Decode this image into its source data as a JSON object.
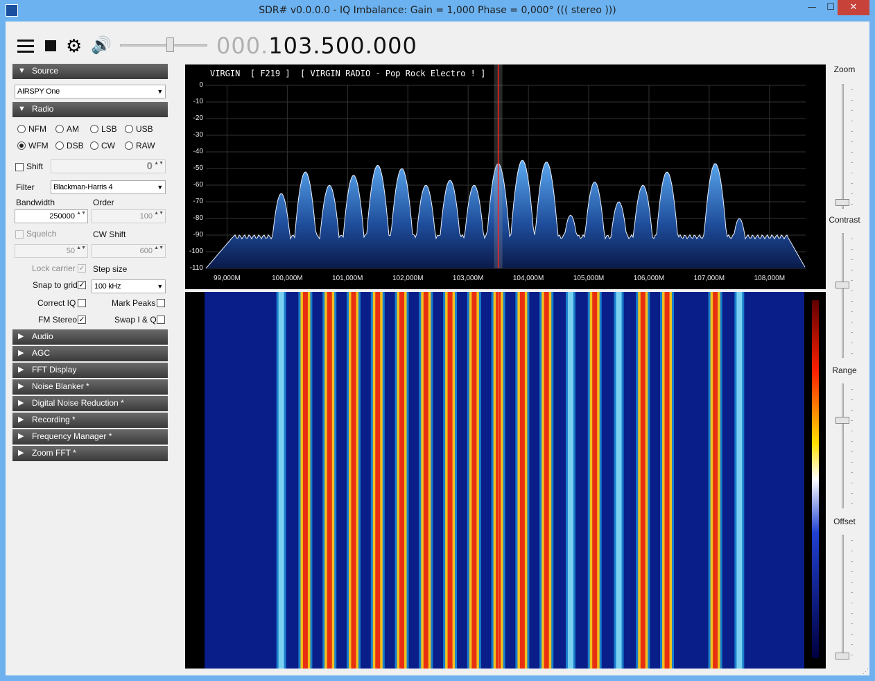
{
  "window": {
    "title": "SDR# v0.0.0.0 - IQ Imbalance: Gain = 1,000 Phase = 0,000° ((( stereo )))",
    "minimize": "—",
    "maximize": "☐",
    "close": "✕"
  },
  "toolbar": {
    "menu_icon": "hamburger-icon",
    "stop_icon": "stop-icon",
    "gear": "⚙",
    "speaker": "🔊",
    "frequency_prefix": "000.",
    "frequency": "103.500.000",
    "volume_level": 0.6
  },
  "sections": {
    "source": "Source",
    "radio": "Radio",
    "audio": "Audio",
    "agc": "AGC",
    "fft": "FFT Display",
    "noise_blanker": "Noise Blanker *",
    "dnr": "Digital Noise Reduction *",
    "recording": "Recording *",
    "freq_manager": "Frequency Manager *",
    "zoom_fft": "Zoom FFT *",
    "arrow_open": "▼",
    "arrow_closed": "▶"
  },
  "source": {
    "device": "AIRSPY One"
  },
  "radio": {
    "modes": [
      "NFM",
      "AM",
      "LSB",
      "USB",
      "WFM",
      "DSB",
      "CW",
      "RAW"
    ],
    "selected_mode": "WFM",
    "shift_label": "Shift",
    "shift_value": "0",
    "filter_label": "Filter",
    "filter_value": "Blackman-Harris 4",
    "bandwidth_label": "Bandwidth",
    "bandwidth_value": "250000",
    "order_label": "Order",
    "order_value": "100",
    "squelch_label": "Squelch",
    "squelch_value": "50",
    "cwshift_label": "CW Shift",
    "cwshift_value": "600",
    "lock_carrier": "Lock carrier",
    "step_size": "Step size",
    "snap_to_grid": "Snap to grid",
    "step_value": "100 kHz",
    "correct_iq": "Correct IQ",
    "mark_peaks": "Mark Peaks",
    "fm_stereo": "FM Stereo",
    "swap_iq": "Swap I & Q",
    "check": "✓",
    "spin": "▲▼",
    "dd": "▼"
  },
  "spectrum": {
    "rds": "VIRGIN  [ F219 ]  [ VIRGIN RADIO - Pop Rock Electro ! ]",
    "db_labels": [
      "0",
      "-10",
      "-20",
      "-30",
      "-40",
      "-50",
      "-60",
      "-70",
      "-80",
      "-90",
      "-100",
      "-110"
    ],
    "freq_labels": [
      "99,000M",
      "100,000M",
      "101,000M",
      "102,000M",
      "103,000M",
      "104,000M",
      "105,000M",
      "106,000M",
      "107,000M",
      "108,000M"
    ],
    "center_mhz": 103.5,
    "stations_mhz": [
      99.9,
      100.3,
      100.7,
      101.1,
      101.5,
      101.9,
      102.3,
      102.7,
      103.1,
      103.5,
      103.9,
      104.3,
      104.7,
      105.1,
      105.5,
      105.9,
      106.3,
      107.1,
      107.5
    ]
  },
  "right": {
    "zoom": "Zoom",
    "contrast": "Contrast",
    "range": "Range",
    "offset": "Offset"
  },
  "colors": {
    "header": "#3a3a3a",
    "spectrum_fill": "#2a5ea8",
    "tuned_line": "#ff2020"
  }
}
